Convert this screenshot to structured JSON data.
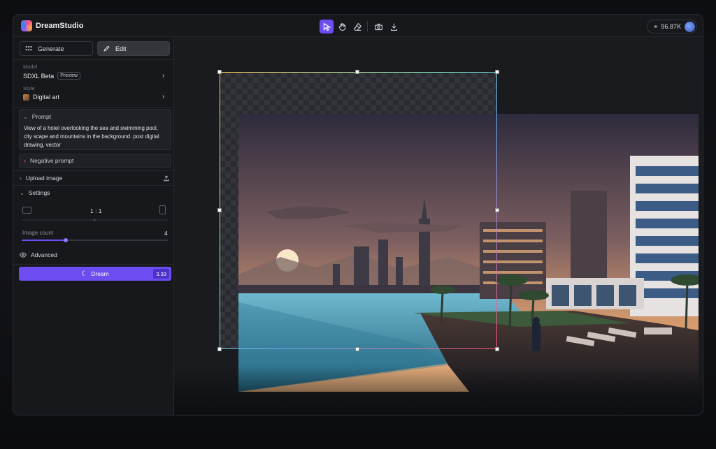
{
  "app": {
    "name": "DreamStudio"
  },
  "toolbar": {
    "tools": [
      "select-icon",
      "hand-icon",
      "eraser-icon",
      "camera-icon",
      "download-icon"
    ],
    "active_tool": "select-icon"
  },
  "account": {
    "credits": "96.87K"
  },
  "modes": {
    "generate": "Generate",
    "edit": "Edit",
    "active": "Edit"
  },
  "model": {
    "label": "Model",
    "value": "SDXL Beta",
    "badge": "Preview"
  },
  "style": {
    "label": "Style",
    "value": "Digital art"
  },
  "prompt": {
    "title": "Prompt",
    "text": "View of a hotel overlooking the sea and swimming pool, city scape and mountains in the background. post digital drawing, vector"
  },
  "negative_prompt": {
    "title": "Negative prompt"
  },
  "upload": {
    "label": "Upload image"
  },
  "settings": {
    "title": "Settings",
    "aspect_ratio": "1 : 1",
    "image_count_label": "Image count",
    "image_count": "4",
    "image_count_fraction": 0.3,
    "advanced_label": "Advanced"
  },
  "dream": {
    "label": "Dream",
    "cost": "3.33"
  },
  "colors": {
    "accent": "#6d4df2",
    "background": "#16171b",
    "panel": "#17181c"
  }
}
